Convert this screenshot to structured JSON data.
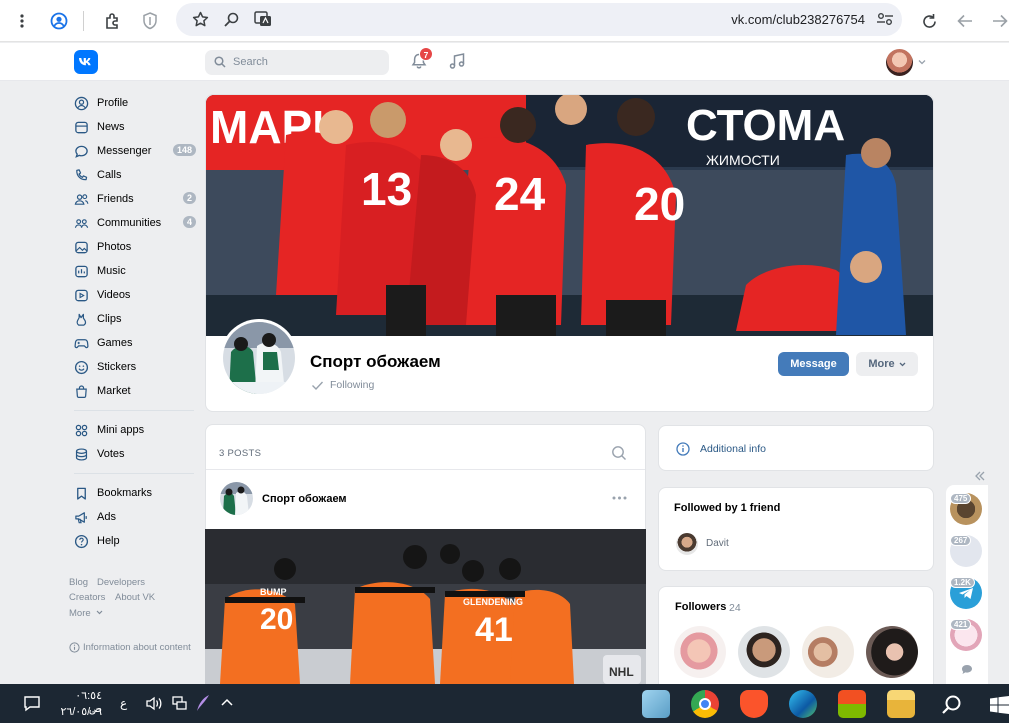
{
  "browser": {
    "url": "vk.com/club238276754"
  },
  "header": {
    "search_placeholder": "Search",
    "notifications_count": "7"
  },
  "sidebar": {
    "items": [
      {
        "label": "Profile",
        "badge": ""
      },
      {
        "label": "News",
        "badge": ""
      },
      {
        "label": "Messenger",
        "badge": "148"
      },
      {
        "label": "Calls",
        "badge": ""
      },
      {
        "label": "Friends",
        "badge": "2"
      },
      {
        "label": "Communities",
        "badge": "4"
      },
      {
        "label": "Photos",
        "badge": ""
      },
      {
        "label": "Music",
        "badge": ""
      },
      {
        "label": "Videos",
        "badge": ""
      },
      {
        "label": "Clips",
        "badge": ""
      },
      {
        "label": "Games",
        "badge": ""
      },
      {
        "label": "Stickers",
        "badge": ""
      },
      {
        "label": "Market",
        "badge": ""
      }
    ],
    "items2": [
      {
        "label": "Mini apps"
      },
      {
        "label": "Votes"
      }
    ],
    "items3": [
      {
        "label": "Bookmarks"
      },
      {
        "label": "Ads"
      },
      {
        "label": "Help"
      }
    ],
    "footer": {
      "blog": "Blog",
      "developers": "Developers",
      "creators": "Creators",
      "about": "About VK",
      "more": "More",
      "info": "Information about content"
    }
  },
  "community": {
    "name": "Спорт обожаем",
    "status": "Following",
    "message_button": "Message",
    "more_button": "More"
  },
  "posts": {
    "count_label": "3 POSTS",
    "author": "Спорт обожаем"
  },
  "right": {
    "additional_info": "Additional info",
    "followed_by": "Followed by 1 friend",
    "friend_name": "Davit",
    "followers_label": "Followers",
    "followers_count": "24"
  },
  "floating": {
    "badges": [
      "475",
      "267",
      "1.2K",
      "421"
    ]
  },
  "taskbar": {
    "time": "٠٦:٥٤ ص",
    "date": "٢٦/٠٥/٠٦",
    "lang": "ع"
  },
  "colors": {
    "vk_blue": "#0077ff",
    "button_blue": "#447bba",
    "badge_red": "#e64646",
    "cover_red": "#e52524"
  }
}
